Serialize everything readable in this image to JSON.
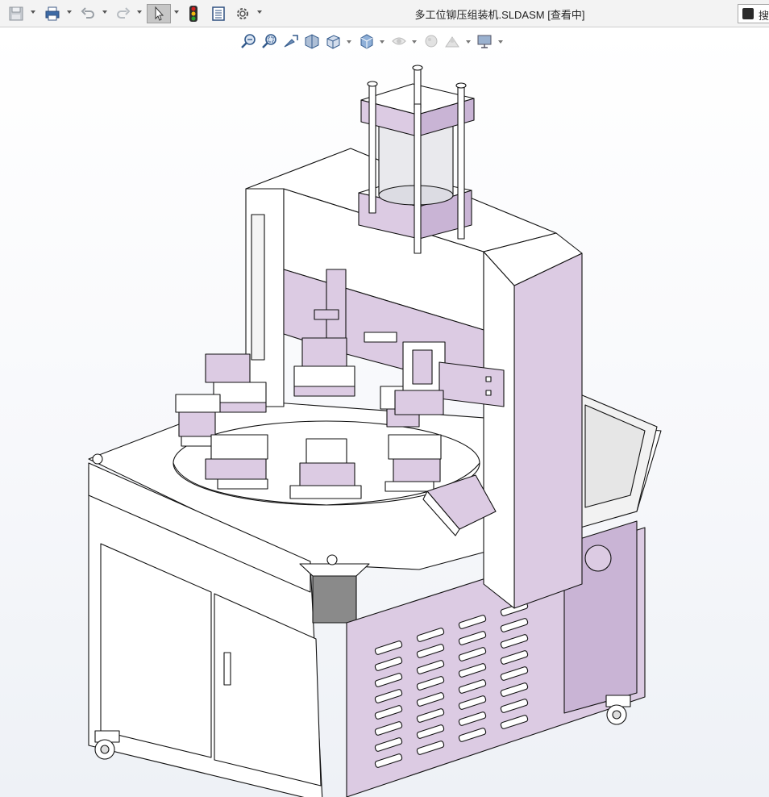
{
  "window": {
    "title": "多工位铆压组装机.SLDASM [查看中]",
    "search_label": "搜"
  },
  "toolbar": {
    "icons": [
      "save-icon",
      "print-icon",
      "undo-icon",
      "redo-icon",
      "select-pointer-icon",
      "rebuild-traffic-light-icon",
      "file-properties-icon",
      "options-gear-icon"
    ]
  },
  "view_toolbar": {
    "icons": [
      "zoom-to-fit-icon",
      "zoom-to-area-icon",
      "previous-view-icon",
      "section-view-icon",
      "view-orientation-icon",
      "display-style-icon",
      "hide-show-items-icon",
      "edit-appearance-icon",
      "apply-scene-icon",
      "view-settings-icon"
    ]
  },
  "colors": {
    "accent_select": "#c6c6c6",
    "traffic_red": "#d21f1f",
    "traffic_yellow": "#f2b90f",
    "traffic_green": "#2aa52a",
    "model_fill": "#dccbe3",
    "model_fill_dark": "#c9b4d5",
    "model_white": "#ffffff",
    "model_dark": "#8a8a8a"
  }
}
